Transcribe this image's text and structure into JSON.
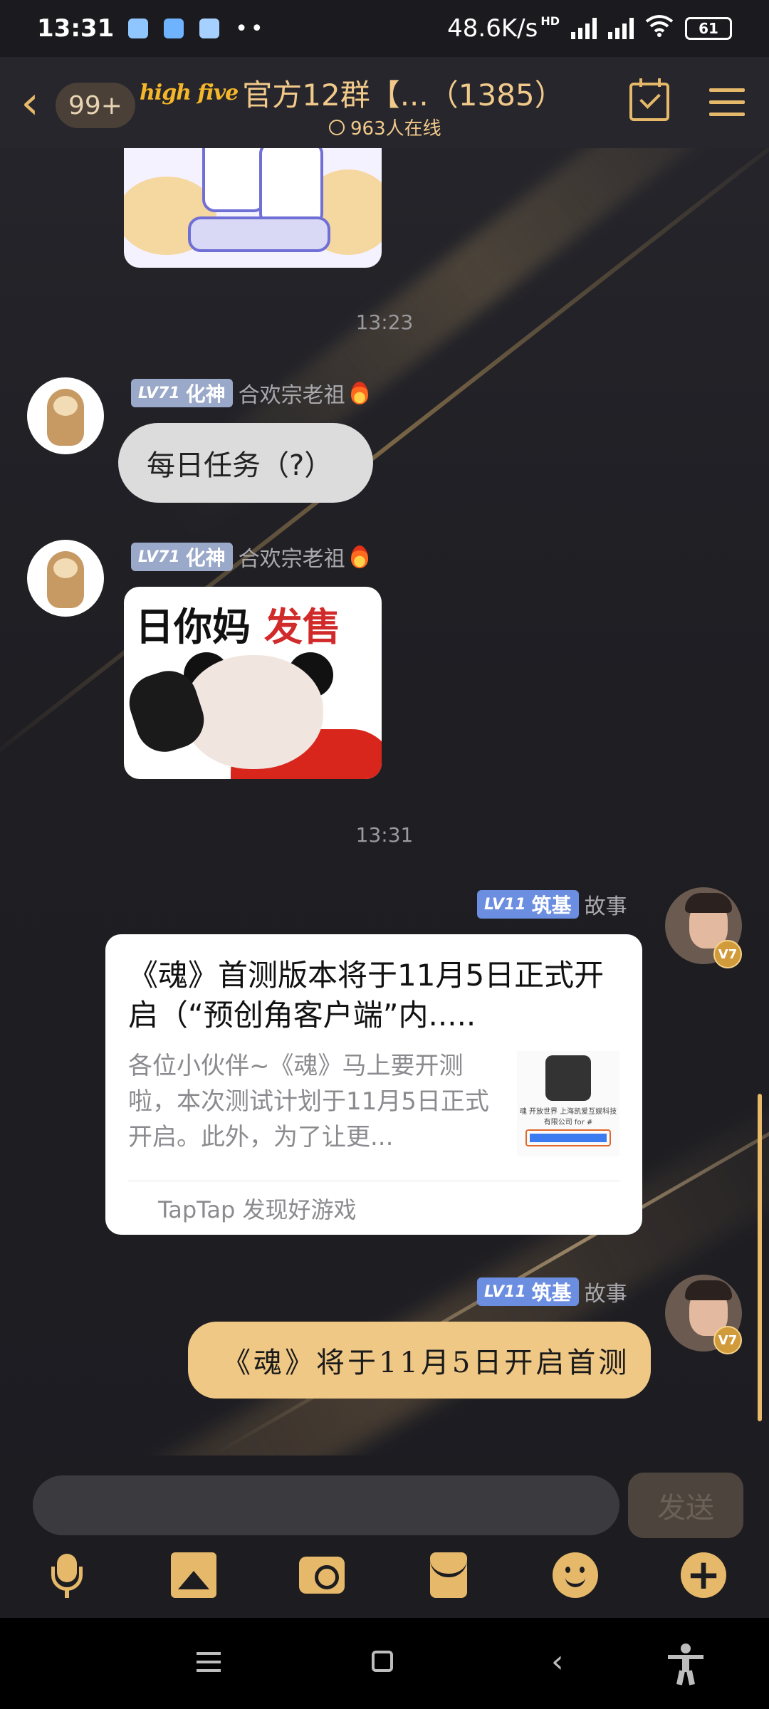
{
  "status_bar": {
    "time": "13:31",
    "net_speed": "48.6K/s",
    "hd_label": "HD",
    "battery": "61"
  },
  "header": {
    "unread": "99+",
    "brand": "high five",
    "title": "官方12群【...（1385）",
    "online": "963人在线"
  },
  "messages": {
    "ts1": "13:23",
    "m1": {
      "level": "LV71",
      "rank": "化神",
      "nick": "合欢宗老祖",
      "text": "每日任务（?）"
    },
    "m2": {
      "level": "LV71",
      "rank": "化神",
      "nick": "合欢宗老祖",
      "sticker_text_a": "日你妈",
      "sticker_text_b": "发售"
    },
    "ts2": "13:31",
    "m3": {
      "level": "LV11",
      "rank": "筑基",
      "nick": "故事",
      "vip": "V7",
      "card_title": "《魂》首测版本将于11月5日正式开启（“预创角客户端”内.....",
      "card_desc": "各位小伙伴~《魂》马上要开测啦，本次测试计划于11月5日正式开启。此外，为了让更...",
      "card_thumb_caption": "魂 开放世界 上海凯爱互娱科技有限公司 for #",
      "card_source": "TapTap 发现好游戏"
    },
    "m4": {
      "level": "LV11",
      "rank": "筑基",
      "nick": "故事",
      "vip": "V7",
      "text": "《魂》将于11月5日开启首测"
    }
  },
  "input": {
    "placeholder": "",
    "send_label": "发送"
  },
  "colors": {
    "accent_gold": "#e6b86a",
    "bubble_gold": "#f0c886",
    "level_badge": "#9aa9c9"
  },
  "icons": {
    "toolbar": [
      "mic-icon",
      "image-icon",
      "camera-icon",
      "redpacket-icon",
      "emoji-icon",
      "plus-icon"
    ],
    "nav": [
      "nav-menu-icon",
      "nav-home-icon",
      "nav-back-icon",
      "accessibility-icon"
    ]
  }
}
